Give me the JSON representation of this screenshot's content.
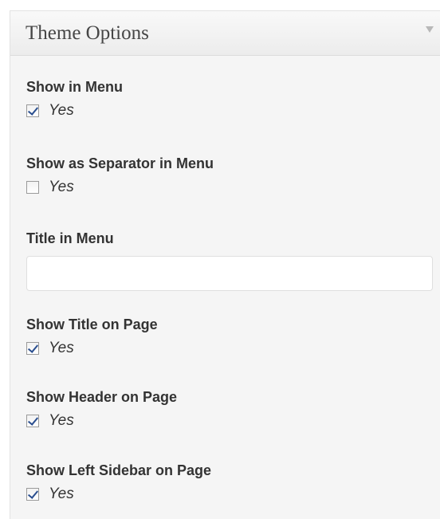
{
  "panel": {
    "title": "Theme Options"
  },
  "fields": {
    "show_in_menu": {
      "label": "Show in Menu",
      "option_label": "Yes",
      "checked": true
    },
    "show_as_separator": {
      "label": "Show as Separator in Menu",
      "option_label": "Yes",
      "checked": false
    },
    "title_in_menu": {
      "label": "Title in Menu",
      "value": "",
      "placeholder": ""
    },
    "show_title_on_page": {
      "label": "Show Title on Page",
      "option_label": "Yes",
      "checked": true
    },
    "show_header_on_page": {
      "label": "Show Header on Page",
      "option_label": "Yes",
      "checked": true
    },
    "show_left_sidebar": {
      "label": "Show Left Sidebar on Page",
      "option_label": "Yes",
      "checked": true
    }
  },
  "icons": {
    "toggle": "chevron-down-icon"
  },
  "colors": {
    "panel_background": "#f5f5f5",
    "label_text": "#333333",
    "checkmark": "#2a4e8f"
  }
}
